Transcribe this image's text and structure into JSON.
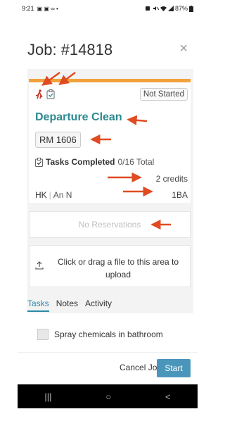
{
  "status_bar": {
    "time": "9:21",
    "left_icons": "▣ ▣ ∞ •",
    "battery": "87%"
  },
  "header": {
    "title": "Job: #14818",
    "close_icon": "×"
  },
  "card": {
    "status": "Not Started",
    "job_type": "Departure Clean",
    "room": "RM 1606",
    "tasks_label": "Tasks Completed",
    "tasks_value": "0/16 Total",
    "credits": "2 credits",
    "hk_label": "HK",
    "hk_separator": "|",
    "hk_name": "An N",
    "beds": "1BA"
  },
  "reservations": {
    "text": "No Reservations"
  },
  "upload": {
    "text": "Click or drag a file to this area to upload"
  },
  "tabs": [
    {
      "label": "Tasks",
      "active": true
    },
    {
      "label": "Notes",
      "active": false
    },
    {
      "label": "Activity",
      "active": false
    }
  ],
  "task": {
    "label": "Spray chemicals in bathroom"
  },
  "footer": {
    "cancel_label": "Cancel Job",
    "start_label": "Start"
  },
  "android_nav": {
    "recents": "|||",
    "home": "○",
    "back": "<"
  },
  "colors": {
    "accent_teal": "#2a8a90",
    "status_orange": "#f2a23a",
    "button_blue": "#4a96bb",
    "annotation_red": "#e04b22"
  }
}
